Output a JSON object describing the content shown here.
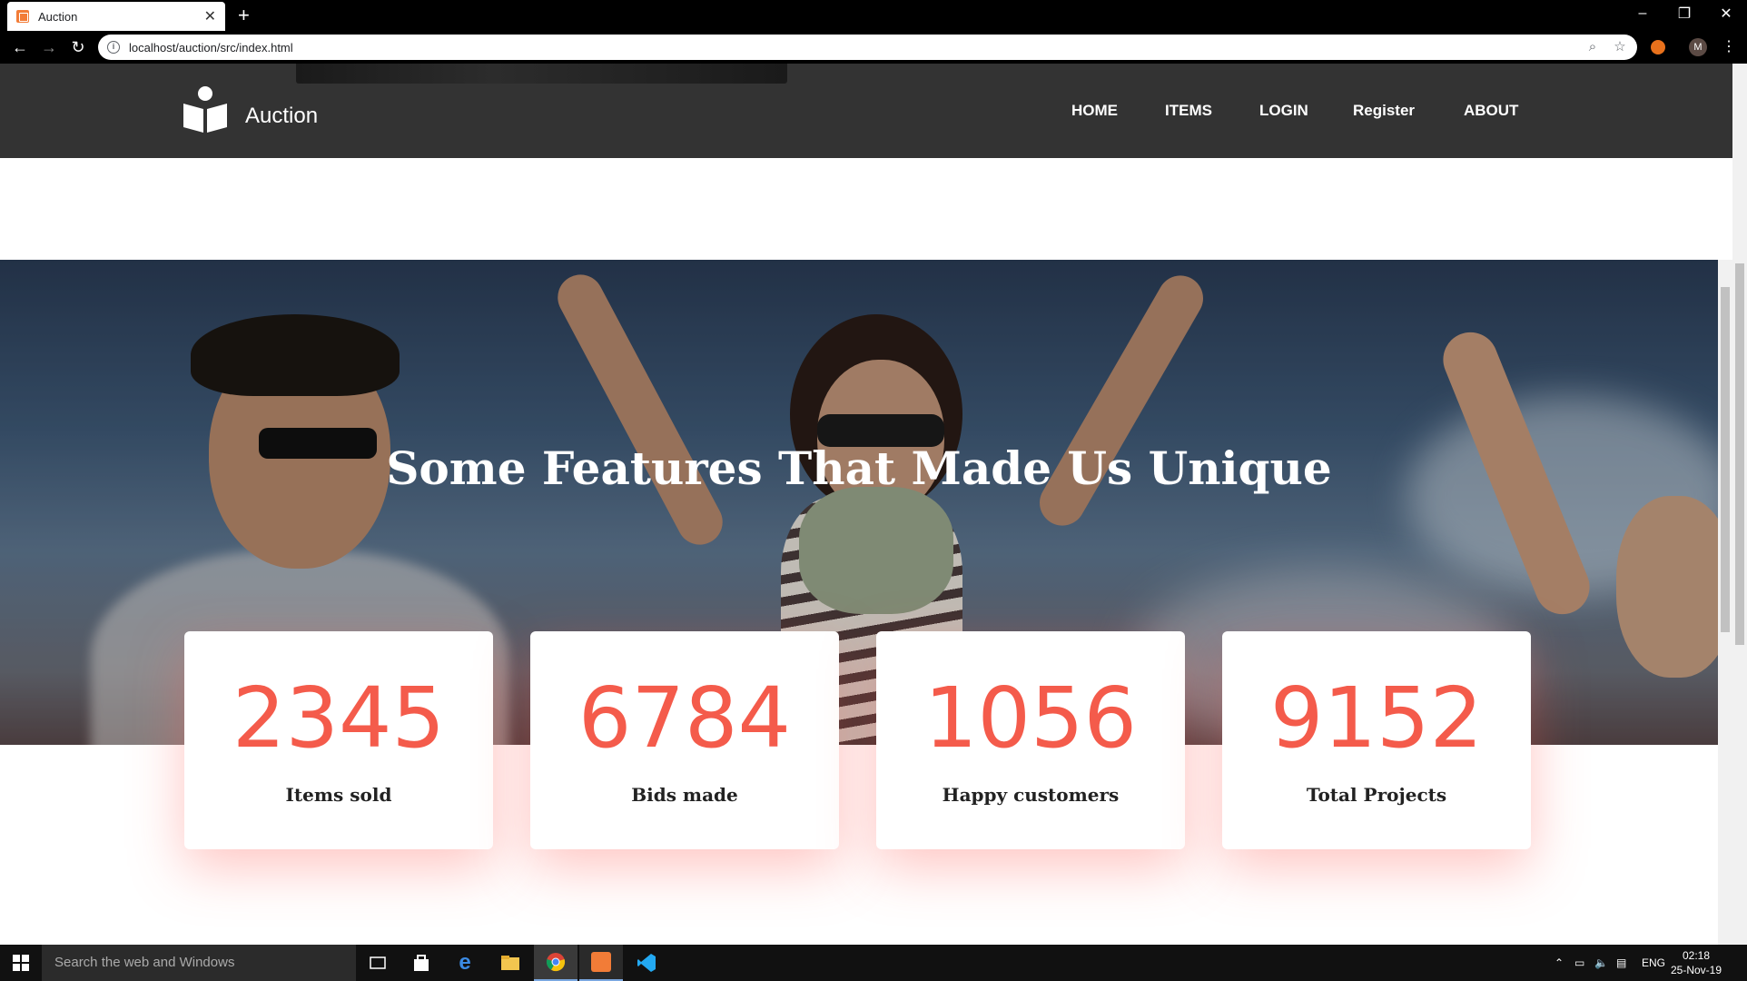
{
  "browser": {
    "tab_title": "Auction",
    "url": "localhost/auction/src/index.html",
    "profile_initial": "M"
  },
  "site": {
    "brand": "Auction",
    "nav": [
      "HOME",
      "ITEMS",
      "LOGIN",
      "Register",
      "ABOUT"
    ]
  },
  "hero": {
    "title": "Some Features That Made Us Unique"
  },
  "stats": [
    {
      "value": "2345",
      "label": "Items sold"
    },
    {
      "value": "6784",
      "label": "Bids made"
    },
    {
      "value": "1056",
      "label": "Happy customers"
    },
    {
      "value": "9152",
      "label": "Total Projects"
    }
  ],
  "taskbar": {
    "search_placeholder": "Search the web and Windows",
    "language": "ENG",
    "time": "02:18",
    "date": "25-Nov-19"
  },
  "colors": {
    "accent": "#f45b4b",
    "nav_bg": "#333333"
  }
}
